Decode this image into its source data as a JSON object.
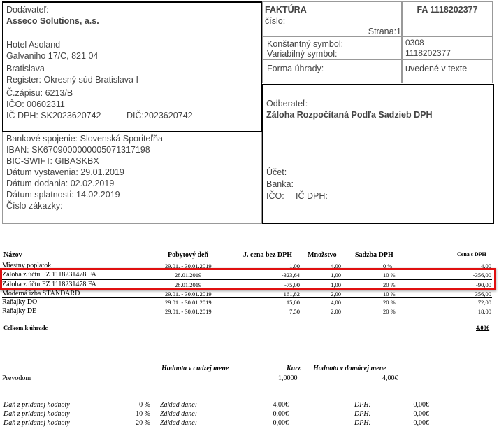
{
  "supplier": {
    "label": "Dodávateľ:",
    "name": "Asseco Solutions, a.s.",
    "lines": [
      "Hotel Asoland",
      "Galvaniho 17/C, 821 04",
      "Bratislava",
      "Register: Okresný súd Bratislava I",
      "Č.zápisu: 6213/B",
      "IČO: 00602311"
    ],
    "dic_label": "IČ DPH: SK2023620742",
    "dic2": "DIČ:2023620742"
  },
  "bank": {
    "lines": [
      "Bankové spojenie: Slovenská Sporiteľňa",
      "IBAN: SK6709000000005071317198",
      "BIC-SWIFT: GIBASKBX",
      "Dátum vystavenia: 29.01.2019",
      "Dátum dodania: 02.02.2019",
      "Dátum splatnosti: 14.02.2019",
      "Číslo zákazky:"
    ]
  },
  "invoice": {
    "title": "FAKTÚRA",
    "number_label": "číslo:",
    "number": "FA 1118202377",
    "page": "Strana:1",
    "const_symbol_label": "Konštantný symbol:",
    "const_symbol": "0308",
    "var_symbol_label": "Variabilný symbol:",
    "var_symbol": "1118202377",
    "payment_label": "Forma úhrady:",
    "payment": "uvedené v texte"
  },
  "customer": {
    "label": "Odberateľ:",
    "name": "Záloha Rozpočítaná Podľa Sadzieb DPH",
    "account": "Účet:",
    "bank": "Banka:",
    "ico": "IČO:",
    "icdph": "IČ DPH:"
  },
  "table": {
    "headers": {
      "name": "Názov",
      "stay": "Pobytový deň",
      "unit_price": "J. cena bez DPH",
      "qty": "Množstvo",
      "vat": "Sadzba DPH",
      "price": "Cena s DPH"
    },
    "rows": [
      {
        "name": "Miestny poplatok",
        "stay": "29.01. - 30.01.2019",
        "unit_price": "1,00",
        "qty": "4,00",
        "vat": "0 %",
        "price": "4,00"
      },
      {
        "name": "Záloha z účtu FZ 1118231478 FA",
        "stay": "28.01.2019",
        "unit_price": "-323,64",
        "qty": "1,00",
        "vat": "10 %",
        "price": "-356,00"
      },
      {
        "name": "Záloha z účtu FZ 1118231478 FA",
        "stay": "28.01.2019",
        "unit_price": "-75,00",
        "qty": "1,00",
        "vat": "20 %",
        "price": "-90,00"
      },
      {
        "name": "Moderná izba STANDARD",
        "stay": "29.01. - 30.01.2019",
        "unit_price": "161,82",
        "qty": "2,00",
        "vat": "10 %",
        "price": "356,00"
      },
      {
        "name": "Raňajky DO",
        "stay": "29.01. - 30.01.2019",
        "unit_price": "15,00",
        "qty": "4,00",
        "vat": "20 %",
        "price": "72,00"
      },
      {
        "name": "Raňajky DE",
        "stay": "29.01. - 30.01.2019",
        "unit_price": "7,50",
        "qty": "2,00",
        "vat": "20 %",
        "price": "18,00"
      }
    ],
    "total_label": "Celkom k úhrade",
    "total": "4,00€"
  },
  "currency": {
    "foreign_label": "Hodnota v cudzej mene",
    "rate_label": "Kurz",
    "domestic_label": "Hodnota v domácej mene",
    "method": "Prevodom",
    "rate": "1,0000",
    "domestic": "4,00€"
  },
  "vat_summary": [
    {
      "label": "Daň z pridanej hodnoty",
      "rate": "0 %",
      "base_label": "Základ dane:",
      "base": "4,00€",
      "dph_label": "DPH:",
      "dph": "0,00€"
    },
    {
      "label": "Daň z pridanej hodnoty",
      "rate": "10 %",
      "base_label": "Základ dane:",
      "base": "0,00€",
      "dph_label": "DPH:",
      "dph": "0,00€"
    },
    {
      "label": "Daň z pridanej hodnoty",
      "rate": "20 %",
      "base_label": "Základ dane:",
      "base": "0,00€",
      "dph_label": "DPH:",
      "dph": "0,00€"
    }
  ],
  "highlight_color": "#e01010"
}
